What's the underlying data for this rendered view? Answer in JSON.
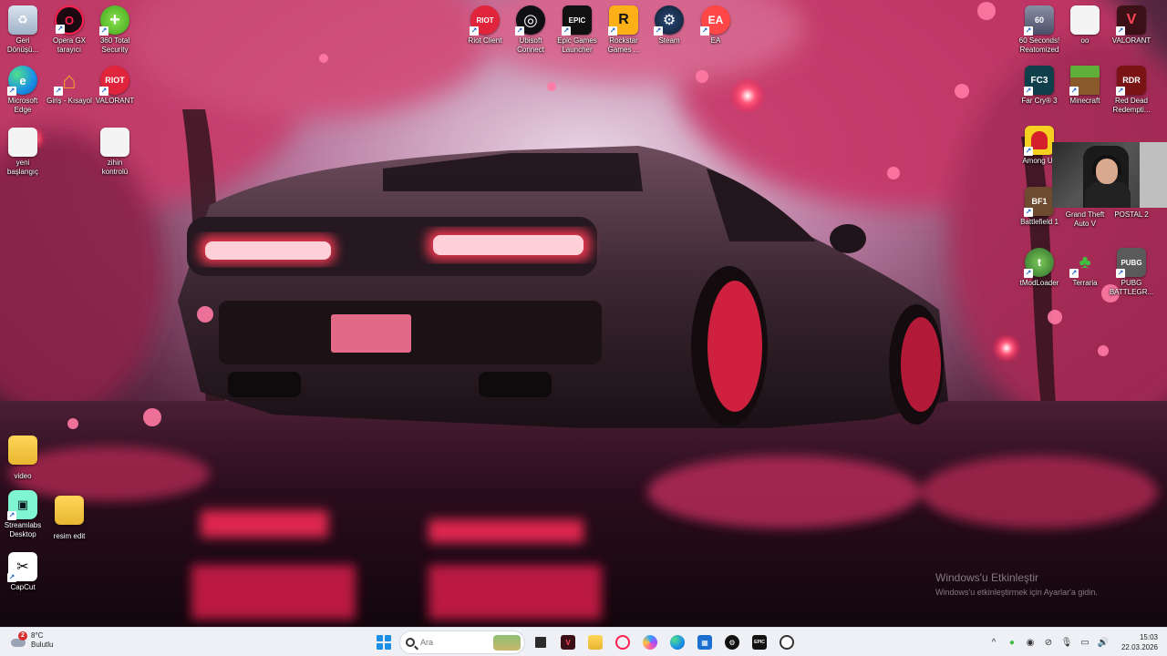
{
  "desktop": {
    "left_icons": [
      {
        "label": "Geri\nDönüşü...",
        "icon": "recycle-bin-icon"
      },
      {
        "label": "Opera GX\ntarayıcı",
        "icon": "opera-gx-icon"
      },
      {
        "label": "360 Total\nSecurity",
        "icon": "360-security-icon"
      },
      {
        "label": "Microsoft\nEdge",
        "icon": "edge-icon"
      },
      {
        "label": "Giriş - Kısayol",
        "icon": "home-icon"
      },
      {
        "label": "VALORANT",
        "icon": "riot-icon"
      },
      {
        "label": "yeni\nbaşlangıç",
        "icon": "file-icon"
      },
      {
        "label": "zihin\nkontrolü",
        "icon": "file-icon"
      },
      {
        "label": "video",
        "icon": "folder-icon"
      },
      {
        "label": "Streamlabs\nDesktop",
        "icon": "streamlabs-icon"
      },
      {
        "label": "resim edit",
        "icon": "folder-icon"
      },
      {
        "label": "CapCut",
        "icon": "capcut-icon"
      }
    ],
    "top_icons": [
      {
        "label": "Riot Client",
        "icon": "riot-client-icon"
      },
      {
        "label": "Ubisoft\nConnect",
        "icon": "ubisoft-icon"
      },
      {
        "label": "Epic Games\nLauncher",
        "icon": "epic-games-icon"
      },
      {
        "label": "Rockstar\nGames ...",
        "icon": "rockstar-icon"
      },
      {
        "label": "Steam",
        "icon": "steam-icon"
      },
      {
        "label": "EA",
        "icon": "ea-icon"
      }
    ],
    "right_icons": [
      {
        "label": "60 Seconds!\nReatomized",
        "icon": "game-icon"
      },
      {
        "label": "oo",
        "icon": "file-icon"
      },
      {
        "label": "VALORANT",
        "icon": "valorant-icon"
      },
      {
        "label": "Far Cry® 3",
        "icon": "farcry-icon"
      },
      {
        "label": "Minecraft",
        "icon": "minecraft-icon"
      },
      {
        "label": "Red Dead\nRedempti...",
        "icon": "rdr-icon"
      },
      {
        "label": "Among Us",
        "icon": "among-us-icon"
      },
      {
        "label": "Battlefield 1",
        "icon": "battlefield-icon"
      },
      {
        "label": "Grand Theft\nAuto V",
        "icon": "gta-icon"
      },
      {
        "label": "POSTAL 2",
        "icon": "postal-icon"
      },
      {
        "label": "tModLoader",
        "icon": "tmodloader-icon"
      },
      {
        "label": "Terraria",
        "icon": "terraria-icon"
      },
      {
        "label": "PUBG\nBATTLEGR...",
        "icon": "pubg-icon"
      }
    ]
  },
  "watermark": {
    "line1": "Windows'u Etkinleştir",
    "line2": "Windows'u etkinleştirmek için Ayarlar'a gidin."
  },
  "taskbar": {
    "weather": {
      "temp": "8°C",
      "condition": "Bulutlu",
      "badge": "2"
    },
    "search": {
      "placeholder": "Ara"
    },
    "apps": [
      "start-icon",
      "search",
      "task-view-icon",
      "valorant-icon",
      "file-explorer-icon",
      "opera-icon",
      "copilot-icon",
      "edge-icon",
      "store-icon",
      "steam-icon",
      "epic-games-icon",
      "ubisoft-icon"
    ],
    "tray": {
      "time": "15:03",
      "date": "22.03.2026"
    }
  },
  "colors": {
    "accent": "#1b8fe6",
    "taskbar_bg": "#eef0f5"
  }
}
